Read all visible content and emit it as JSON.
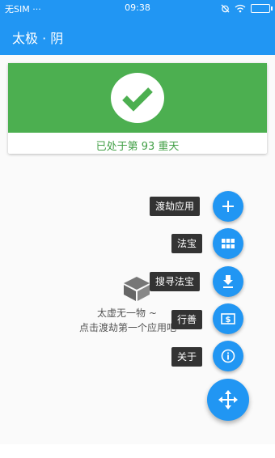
{
  "status_bar": {
    "carrier": "无SIM ···",
    "time": "09:38"
  },
  "app_bar": {
    "title": "太极 · 阴"
  },
  "status_card": {
    "text": "已处于第 93 重天",
    "accent": "#4caf50",
    "icon": "check-icon"
  },
  "empty_state": {
    "title": "太虚无一物 ~",
    "hint": "点击渡劫第一个应用吧 ~"
  },
  "fab_menu": {
    "items": [
      {
        "label": "渡劫应用",
        "icon": "plus-icon"
      },
      {
        "label": "法宝",
        "icon": "grid-icon"
      },
      {
        "label": "搜寻法宝",
        "icon": "download-icon"
      },
      {
        "label": "行善",
        "icon": "donate-icon"
      },
      {
        "label": "关于",
        "icon": "info-icon"
      }
    ],
    "main_icon": "move-arrows-icon",
    "color": "#2196f3"
  }
}
